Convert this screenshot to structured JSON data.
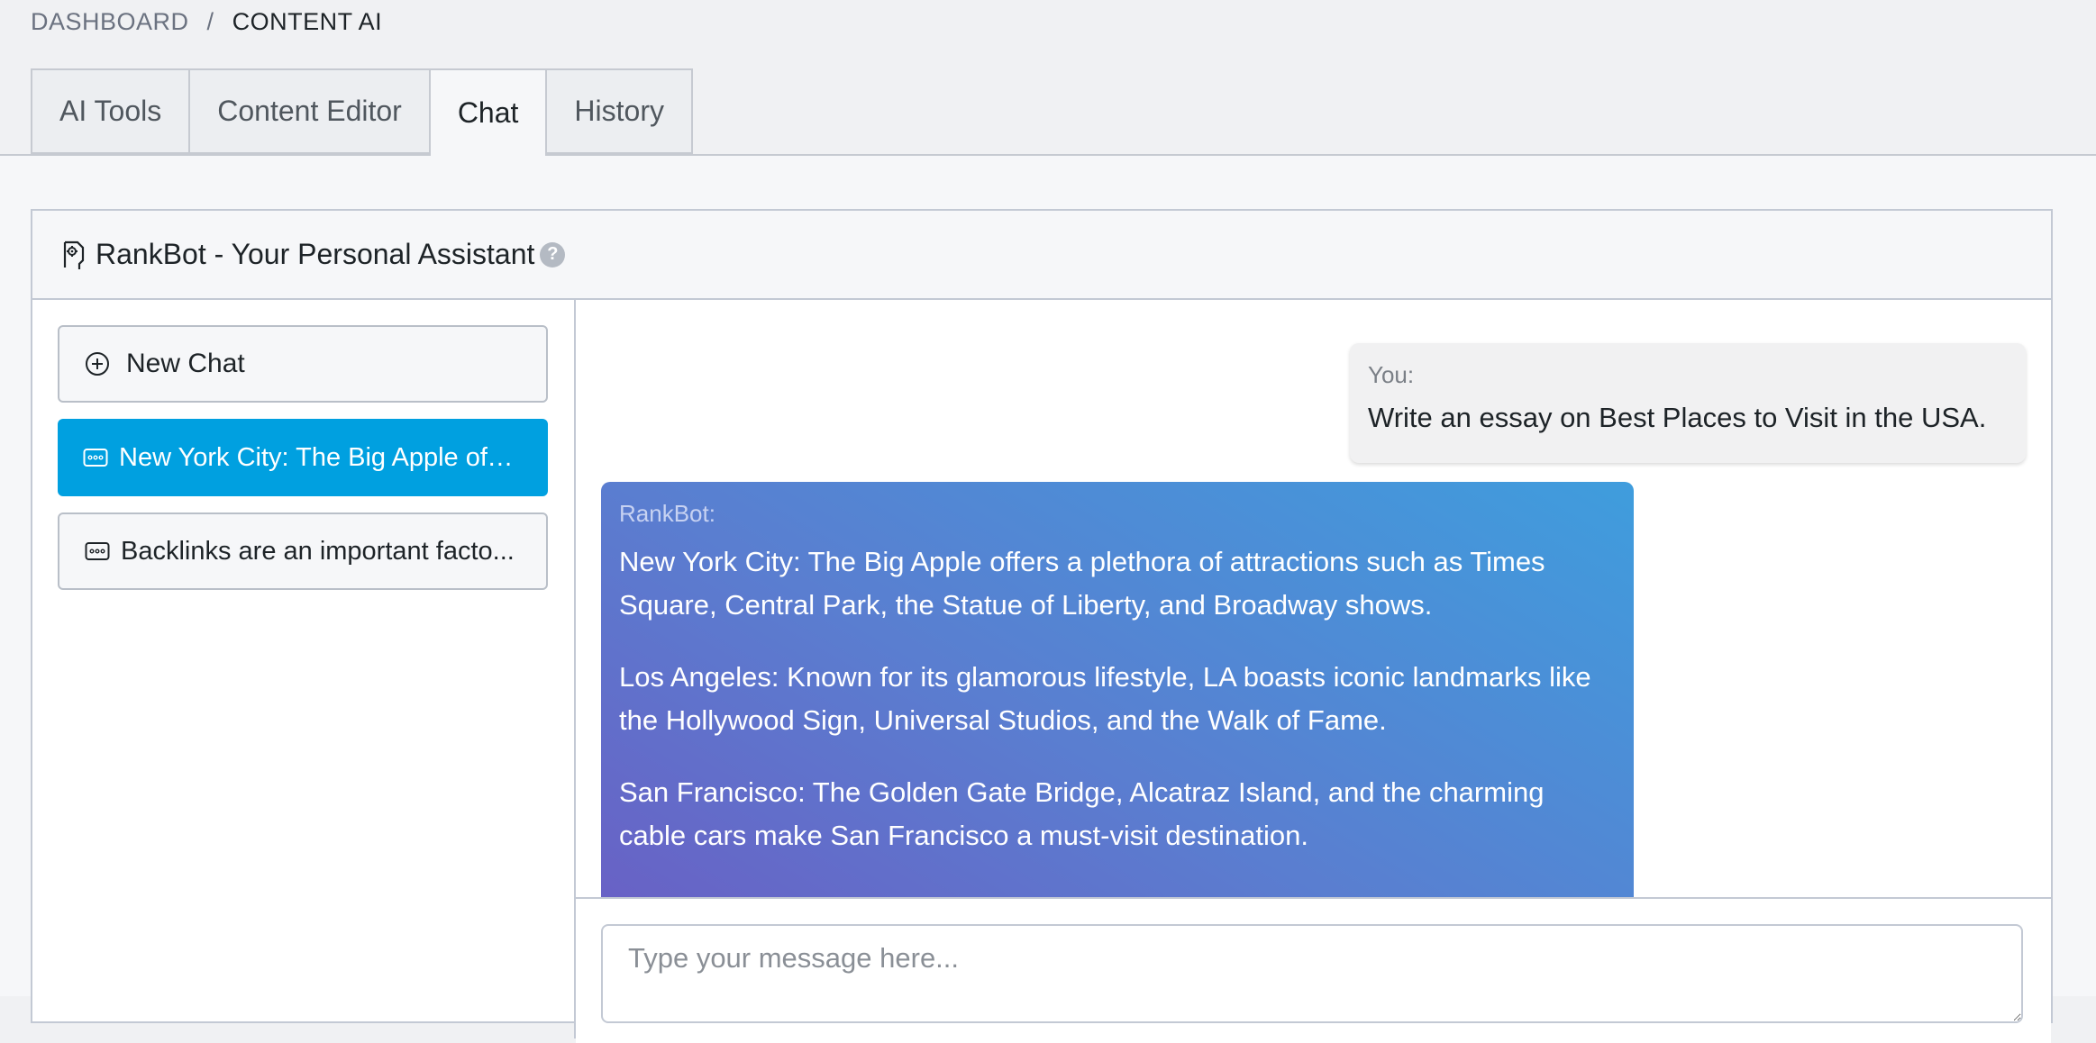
{
  "breadcrumb": {
    "root": "DASHBOARD",
    "separator": "/",
    "current": "CONTENT AI"
  },
  "tabs": [
    {
      "label": "AI Tools",
      "active": false
    },
    {
      "label": "Content Editor",
      "active": false
    },
    {
      "label": "Chat",
      "active": true
    },
    {
      "label": "History",
      "active": false
    }
  ],
  "panel": {
    "title": "RankBot - Your Personal Assistant",
    "title_icon": "robot-icon",
    "help_icon": "question-circle-icon"
  },
  "sidebar": {
    "new_chat_label": "New Chat",
    "new_chat_icon": "plus-circle-icon",
    "chats": [
      {
        "label": "New York City: The Big Apple off...",
        "active": true,
        "icon": "message-icon"
      },
      {
        "label": "Backlinks are an important facto...",
        "active": false,
        "icon": "message-icon"
      }
    ]
  },
  "conversation": {
    "user": {
      "sender": "You:",
      "text": "Write an essay on Best Places to Visit in the USA."
    },
    "bot": {
      "sender": "RankBot:",
      "paragraphs": [
        "New York City: The Big Apple offers a plethora of attractions such as Times Square, Central Park, the Statue of Liberty, and Broadway shows.",
        "Los Angeles: Known for its glamorous lifestyle, LA boasts iconic landmarks like the Hollywood Sign, Universal Studios, and the Walk of Fame.",
        "San Francisco: The Golden Gate Bridge, Alcatraz Island, and the charming cable cars make San Francisco a must-visit destination."
      ]
    }
  },
  "composer": {
    "placeholder": "Type your message here...",
    "value": ""
  },
  "colors": {
    "active_chat": "#00a0e0",
    "bot_gradient_start": "#6a5ec4",
    "bot_gradient_end": "#3f9ddd"
  }
}
